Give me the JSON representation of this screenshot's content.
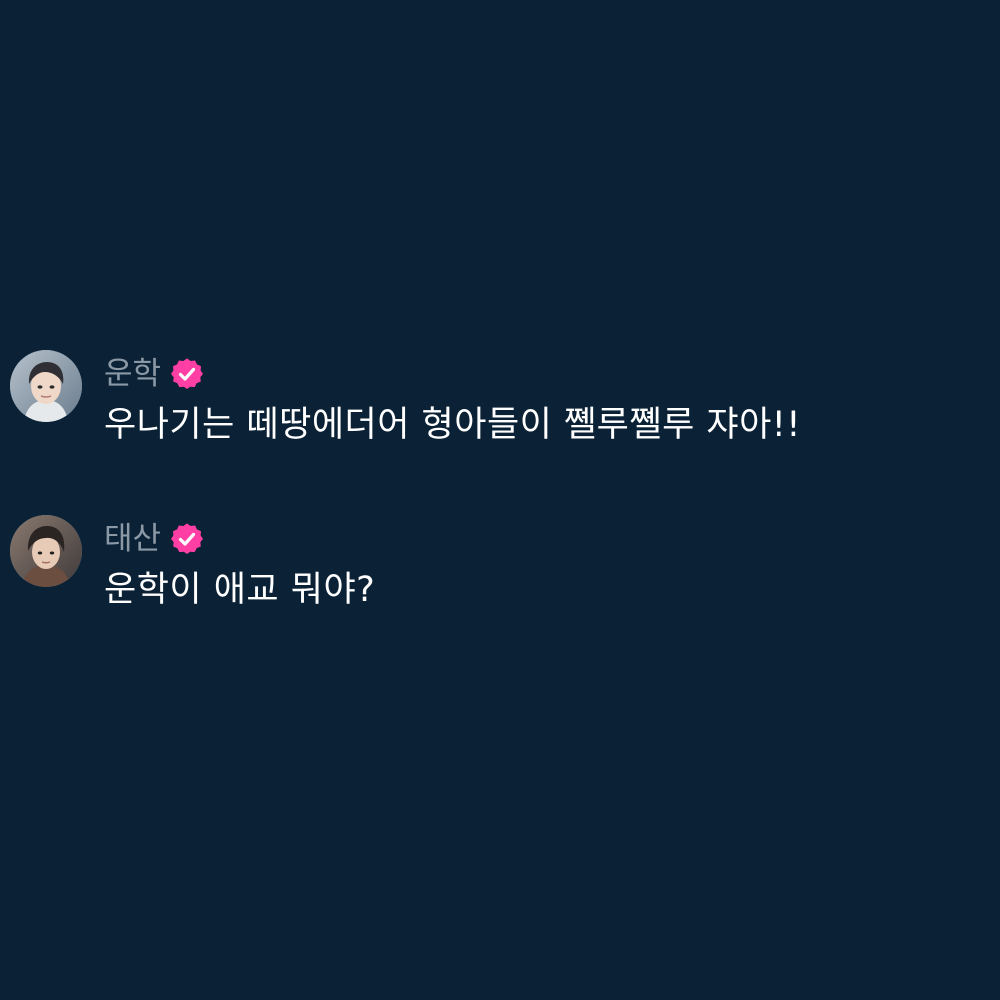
{
  "colors": {
    "background": "#0b2236",
    "name": "#8b99a6",
    "message_text": "#ffffff",
    "verified_badge": "#ff3fa4"
  },
  "comments": [
    {
      "author": "운학",
      "avatar_icon": "avatar-icon",
      "verified_icon": "verified-badge-icon",
      "text": "우나기는 떼땅에더어 형아들이 쪨루쪨루 쟈아!!"
    },
    {
      "author": "태산",
      "avatar_icon": "avatar-icon",
      "verified_icon": "verified-badge-icon",
      "text": "운학이 애교 뭐야?"
    }
  ]
}
